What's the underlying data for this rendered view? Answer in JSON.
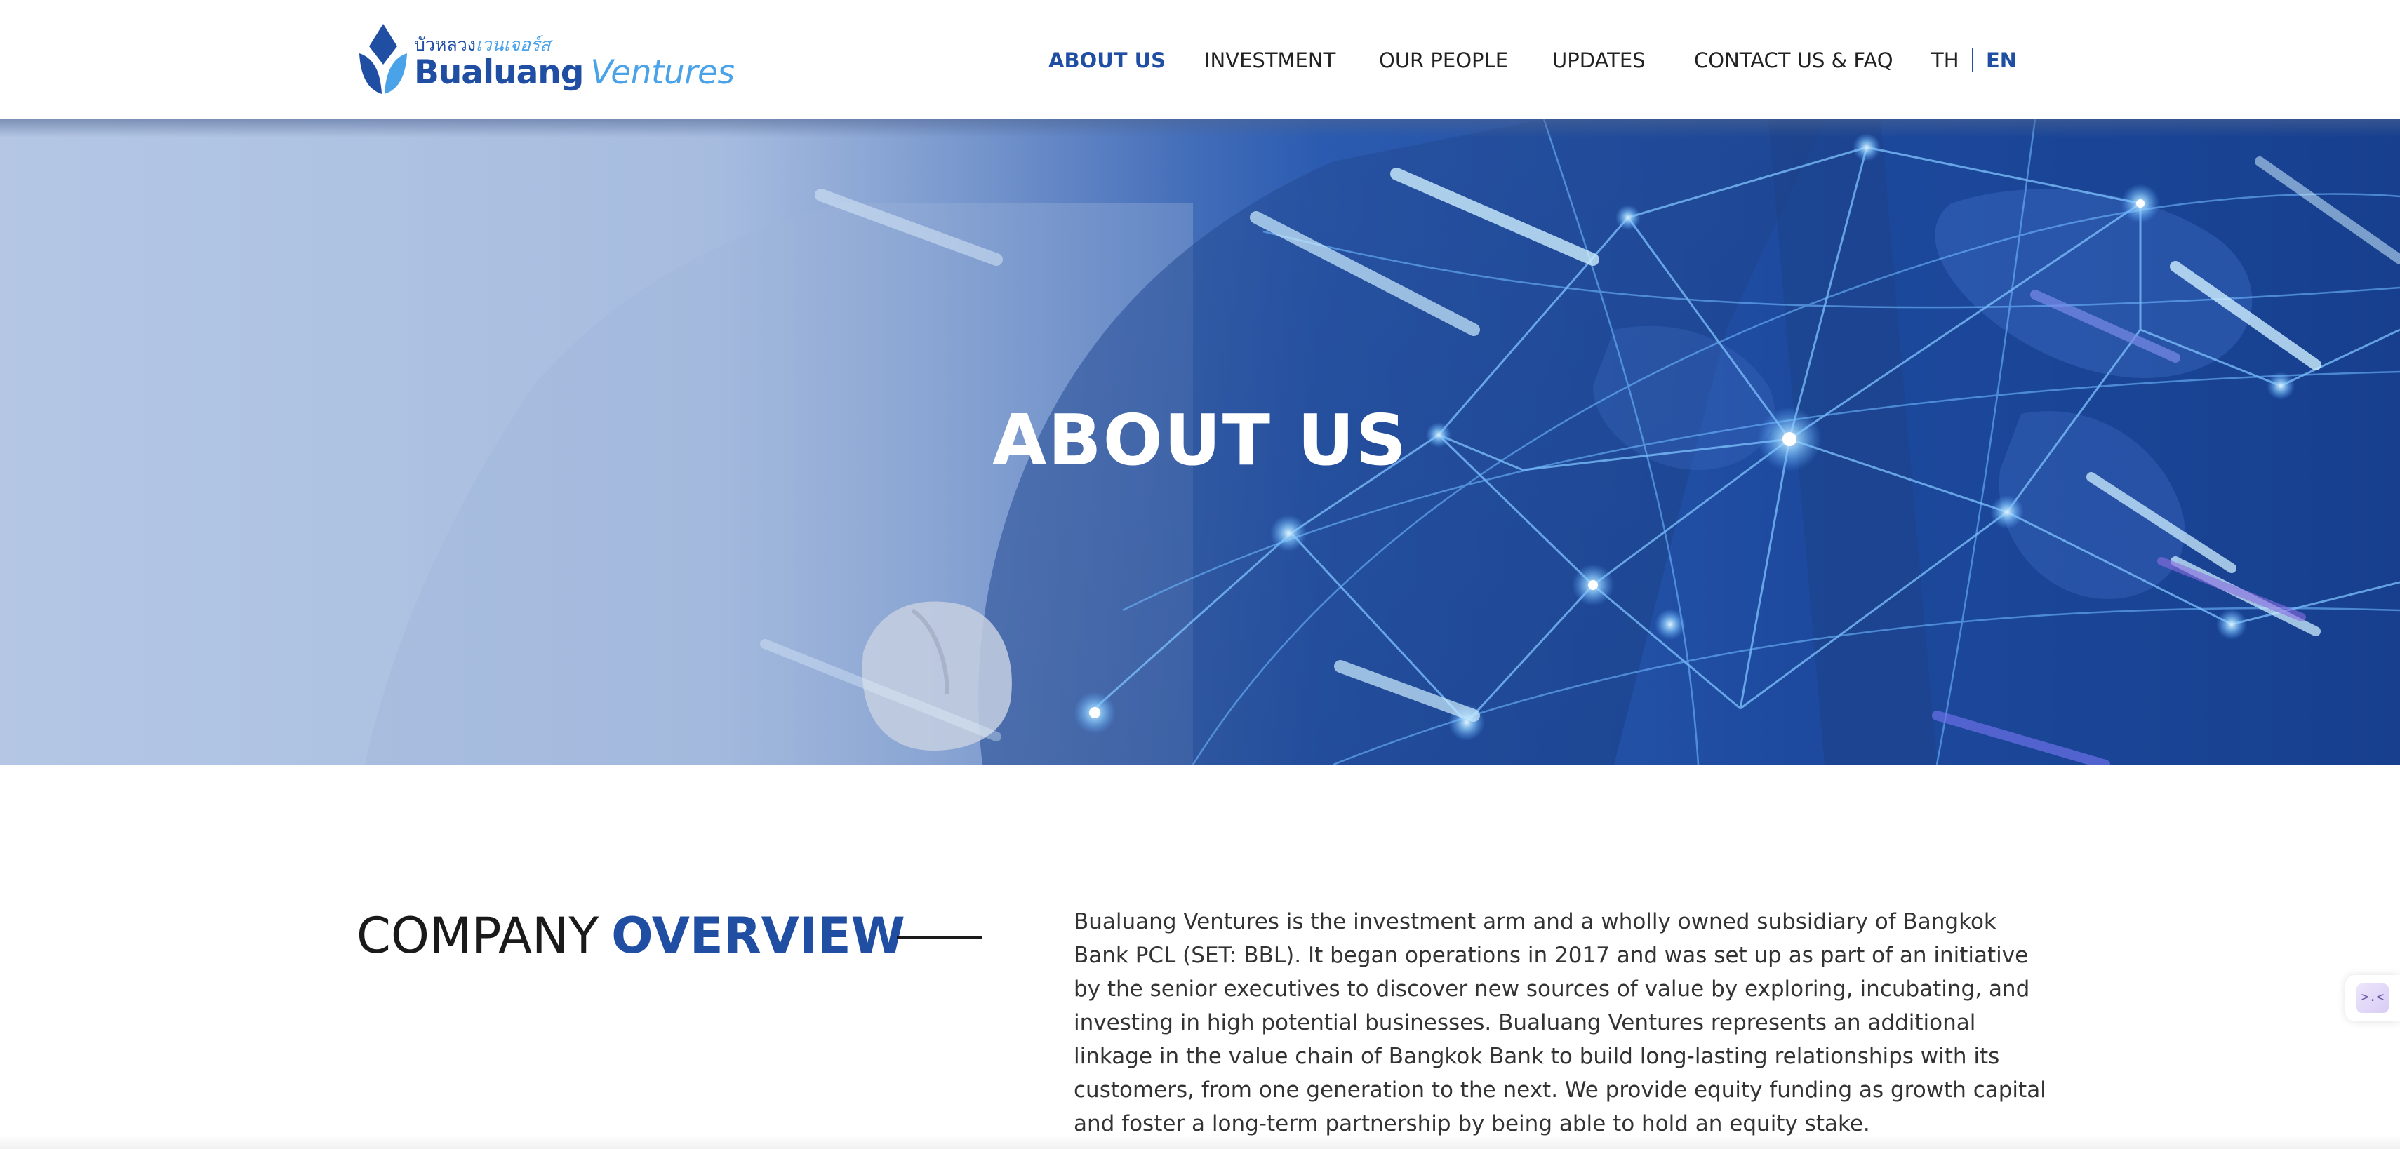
{
  "header": {
    "logo": {
      "thai_part1": "บัวหลวง",
      "thai_part2": "เวนเจอร์ส",
      "name_part1": "Bualuang",
      "name_part2": "Ventures",
      "brand_dark": "#1f4ea3",
      "brand_light": "#4aa2e8"
    },
    "nav": [
      {
        "label": "ABOUT US",
        "active": true
      },
      {
        "label": "INVESTMENT",
        "active": false
      },
      {
        "label": "OUR PEOPLE",
        "active": false
      },
      {
        "label": "UPDATES",
        "active": false
      },
      {
        "label": "CONTACT US & FAQ",
        "active": false
      }
    ],
    "languages": [
      {
        "label": "TH",
        "active": false
      },
      {
        "label": "EN",
        "active": true
      }
    ],
    "active_color": "#1f4ea3"
  },
  "hero": {
    "title": "ABOUT US"
  },
  "overview": {
    "heading_part1": "COMPANY",
    "heading_part2": "OVERVIEW",
    "body": "Bualuang Ventures is the investment arm and a wholly owned subsidiary of Bangkok Bank PCL (SET: BBL). It began operations in 2017 and was set up as part of an initiative by the senior executives to discover new sources of value by exploring, incubating, and investing in high potential businesses. Bualuang Ventures represents an additional linkage in the value chain of Bangkok Bank to build long-lasting relationships with its customers, from one generation to the next. We provide equity funding as growth capital and foster a long-term partnership by being able to hold an equity stake."
  },
  "widget": {
    "icon": "collapse-panel-icon",
    "glyph": ">.<"
  }
}
